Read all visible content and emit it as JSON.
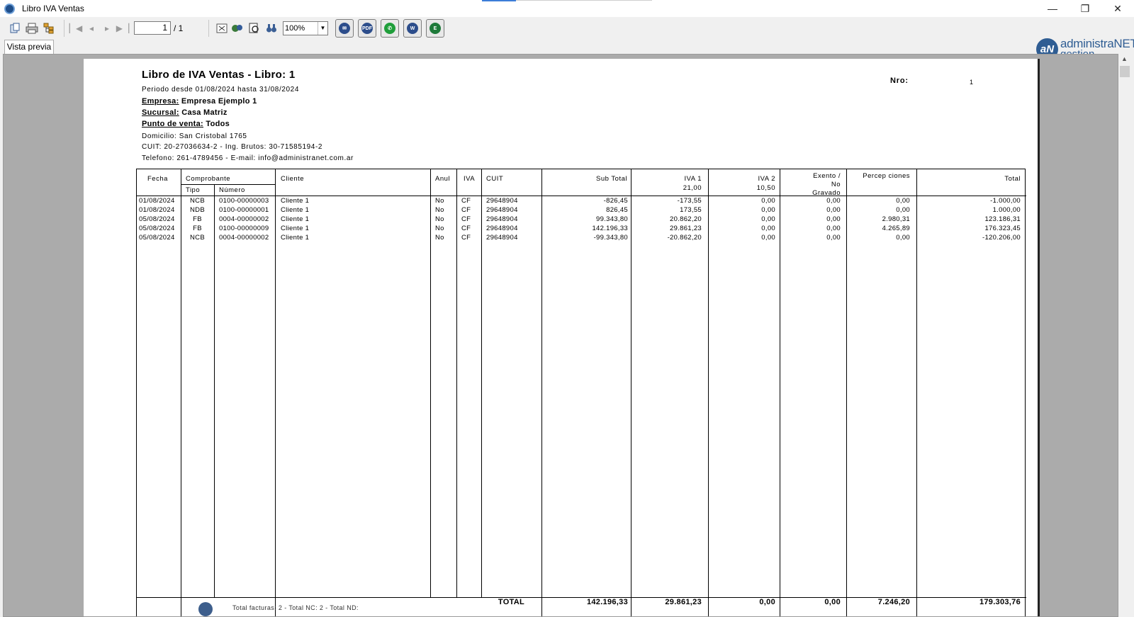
{
  "window": {
    "title": "Libro IVA Ventas",
    "minimize": "—",
    "restore": "❐",
    "close": "✕"
  },
  "toolbar": {
    "page_current": "1",
    "page_total": "/ 1",
    "zoom": "100%",
    "logo_line1": "administraNET",
    "logo_line2": "gestion",
    "logo_mark": "aN"
  },
  "tabs": {
    "preview": "Vista previa"
  },
  "report": {
    "title": "Libro de IVA Ventas  - Libro: 1",
    "period": "Periodo desde  01/08/2024 hasta 31/08/2024",
    "empresa_label": "Empresa:",
    "empresa_value": "Empresa Ejemplo 1",
    "sucursal_label": "Sucursal:",
    "sucursal_value": "Casa Matriz",
    "punto_label": "Punto de venta:",
    "punto_value": "Todos",
    "domicilio": "Domicilio: San Cristobal 1765",
    "cuit": "CUIT: 20-27036634-2 - Ing. Brutos: 30-71585194-2",
    "telefono": "Telefono: 261-4789456 - E-mail: info@administranet.com.ar",
    "nro_label": "Nro:",
    "nro_value": "1"
  },
  "table": {
    "headers": {
      "fecha": "Fecha",
      "comprobante": "Comprobante",
      "tipo": "Tipo",
      "numero": "Número",
      "cliente": "Cliente",
      "anul": "Anul",
      "iva": "IVA",
      "cuit": "CUIT",
      "subtotal": "Sub Total",
      "iva1": "IVA  1",
      "iva1_rate": "21,00",
      "iva2": "IVA  2",
      "iva2_rate": "10,50",
      "exento1": "Exento /",
      "exento2": "No",
      "exento3": "Gravado",
      "percep": "Percep ciones",
      "total": "Total"
    },
    "rows": [
      [
        "01/08/2024",
        "NCB",
        "0100-00000003",
        "Cliente 1",
        "No",
        "CF",
        "29648904",
        "-826,45",
        "-173,55",
        "0,00",
        "0,00",
        "0,00",
        "-1.000,00"
      ],
      [
        "01/08/2024",
        "NDB",
        "0100-00000001",
        "Cliente 1",
        "No",
        "CF",
        "29648904",
        "826,45",
        "173,55",
        "0,00",
        "0,00",
        "0,00",
        "1.000,00"
      ],
      [
        "05/08/2024",
        "FB",
        "0004-00000002",
        "Cliente 1",
        "No",
        "CF",
        "29648904",
        "99.343,80",
        "20.862,20",
        "0,00",
        "0,00",
        "2.980,31",
        "123.186,31"
      ],
      [
        "05/08/2024",
        "FB",
        "0100-00000009",
        "Cliente 1",
        "No",
        "CF",
        "29648904",
        "142.196,33",
        "29.861,23",
        "0,00",
        "0,00",
        "4.265,89",
        "176.323,45"
      ],
      [
        "05/08/2024",
        "NCB",
        "0004-00000002",
        "Cliente 1",
        "No",
        "CF",
        "29648904",
        "-99.343,80",
        "-20.862,20",
        "0,00",
        "0,00",
        "0,00",
        "-120.206,00"
      ]
    ],
    "totals": {
      "label": "TOTAL",
      "subtotal": "142.196,33",
      "iva1": "29.861,23",
      "iva2": "0,00",
      "exento": "0,00",
      "percep": "7.246,20",
      "total": "179.303,76"
    },
    "footer_note": "Total facturas: 2 - Total NC: 2 - Total ND:"
  }
}
